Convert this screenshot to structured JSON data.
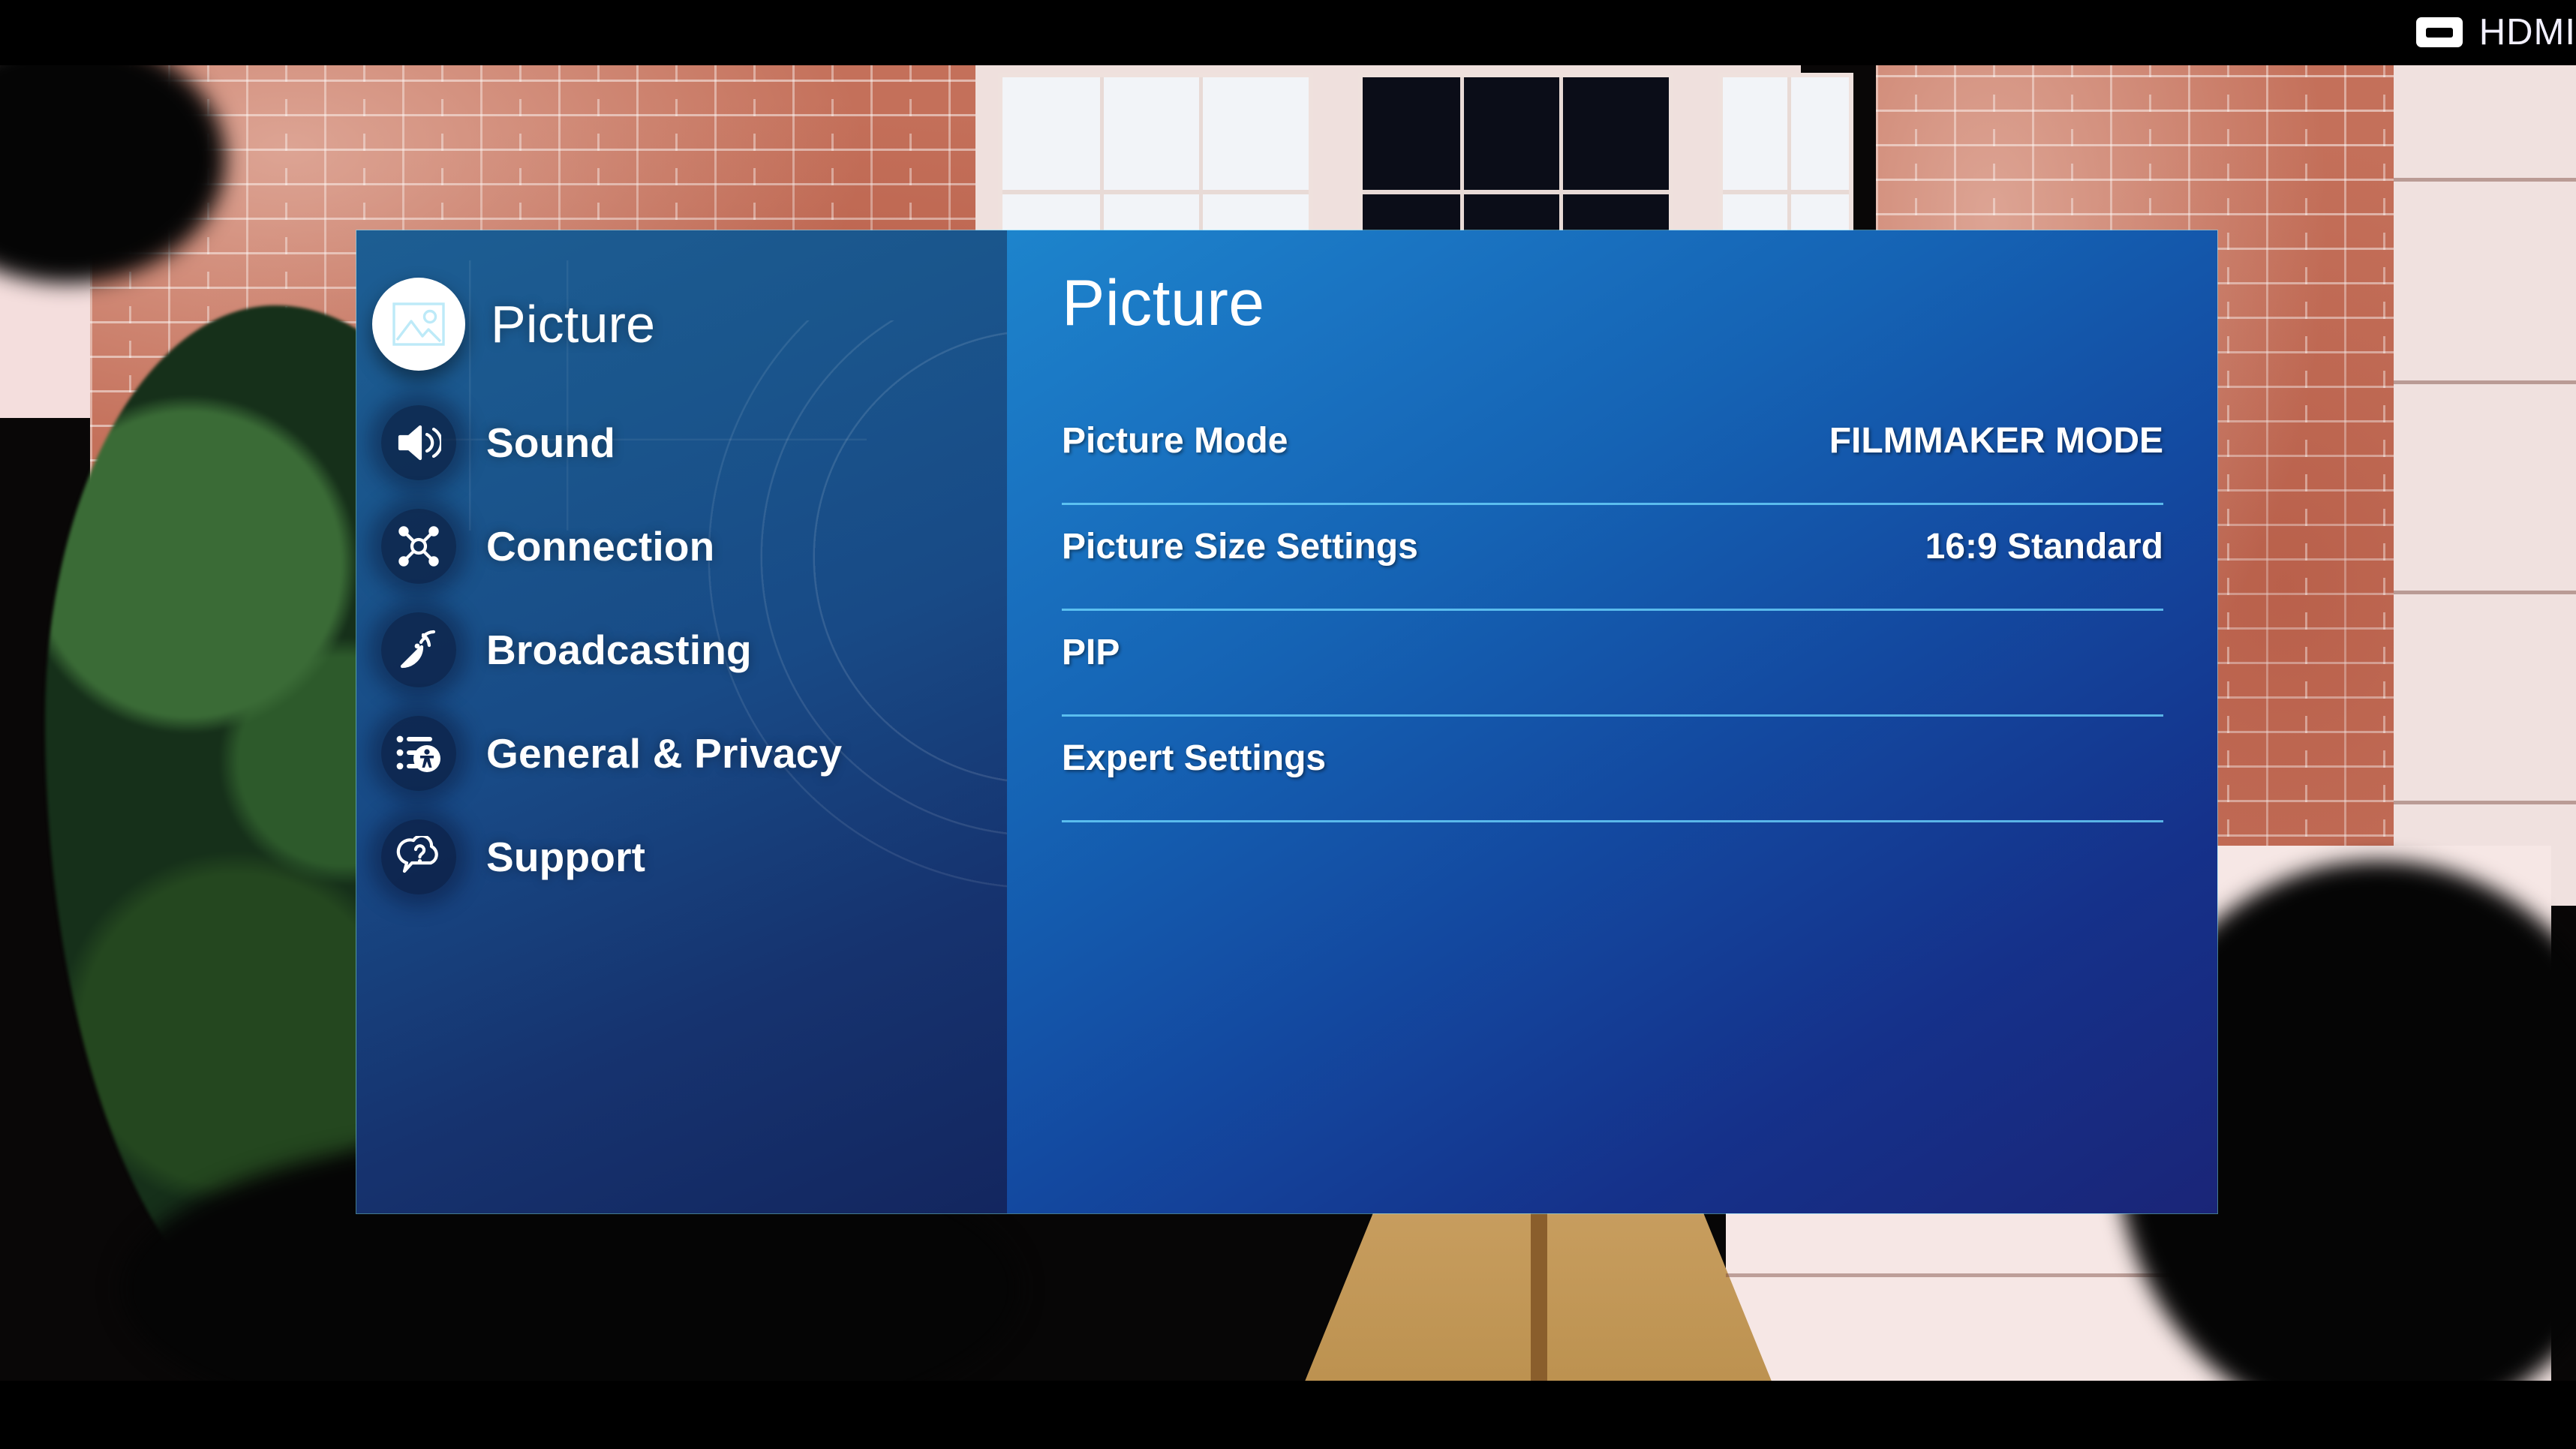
{
  "source_badge": {
    "label": "HDMI",
    "icon": "hdmi-port-icon"
  },
  "menu": {
    "sidebar": {
      "items": [
        {
          "label": "Picture",
          "icon": "picture-icon",
          "active": true
        },
        {
          "label": "Sound",
          "icon": "speaker-icon",
          "active": false
        },
        {
          "label": "Connection",
          "icon": "network-nodes-icon",
          "active": false
        },
        {
          "label": "Broadcasting",
          "icon": "satellite-dish-icon",
          "active": false
        },
        {
          "label": "General & Privacy",
          "icon": "list-accessibility-icon",
          "active": false
        },
        {
          "label": "Support",
          "icon": "question-bubble-icon",
          "active": false
        }
      ]
    },
    "main": {
      "title": "Picture",
      "rows": [
        {
          "name": "Picture Mode",
          "value": "FILMMAKER MODE"
        },
        {
          "name": "Picture Size Settings",
          "value": "16:9 Standard"
        },
        {
          "name": "PIP",
          "value": ""
        },
        {
          "name": "Expert Settings",
          "value": ""
        }
      ]
    }
  },
  "colors": {
    "sidebar_top": "#1d5e93",
    "sidebar_bottom": "#13265f",
    "main_top": "#1d84cc",
    "main_bottom": "#1a2578",
    "divider": "#6ed7ff",
    "text": "#ffffff",
    "active_bubble": "#ffffff",
    "active_icon": "#bdeaf8",
    "letterbox": "#000000"
  }
}
